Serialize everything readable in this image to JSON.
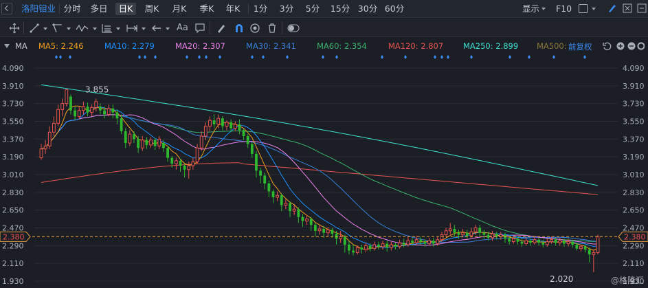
{
  "toolbar": {
    "stock_name": "洛阳钼业",
    "periods": [
      "分时",
      "多日",
      "日K",
      "周K",
      "月K",
      "季K",
      "年K",
      "1分",
      "3分",
      "5分",
      "15分",
      "30分",
      "60分"
    ],
    "active_period": "日K",
    "display_label": "显示",
    "f10_label": "F10"
  },
  "drawing_tools": {
    "icons": [
      "crosshair-icon",
      "line-tool-icon",
      "channel-tool-icon",
      "wave-tool-icon",
      "fib-tool-icon",
      "range-tool-icon",
      "arrow-tool-icon",
      "text-tool-icon",
      "comment-tool-icon",
      "pen-icon",
      "magnet-icon",
      "eye-icon",
      "trash-icon",
      "toggle-icon"
    ],
    "text_tool_label": "Aa"
  },
  "indicator": {
    "name": "MA",
    "adjust_label": "前复权",
    "mas": [
      {
        "label": "MA5: 2.246",
        "color": "#f0a020"
      },
      {
        "label": "MA10: 2.279",
        "color": "#1e90ff"
      },
      {
        "label": "MA20: 2.307",
        "color": "#ee82ee"
      },
      {
        "label": "MA30: 2.341",
        "color": "#3a7fd8"
      },
      {
        "label": "MA60: 2.354",
        "color": "#3cb371"
      },
      {
        "label": "MA120: 2.807",
        "color": "#e8544f"
      },
      {
        "label": "MA250: 2.899",
        "color": "#40e0d0"
      },
      {
        "label": "MA500:",
        "color": "#8a7a3a"
      }
    ]
  },
  "watermark": "@格隆汇",
  "chart_data": {
    "type": "candlestick",
    "y_ticks": [
      4.09,
      3.91,
      3.73,
      3.55,
      3.37,
      3.19,
      3.01,
      2.83,
      2.65,
      2.47,
      2.29,
      2.11,
      1.93
    ],
    "ylim": [
      1.91,
      4.12
    ],
    "current_price": "2.380",
    "annotations": [
      {
        "label": "3.855",
        "value": 3.855
      },
      {
        "label": "2.020",
        "value": 2.02
      }
    ],
    "colors": {
      "up": "#e8544f",
      "down": "#2eb82e"
    },
    "candles": [
      [
        3.18,
        3.27,
        3.16,
        3.32
      ],
      [
        3.27,
        3.3,
        3.22,
        3.36
      ],
      [
        3.3,
        3.44,
        3.27,
        3.5
      ],
      [
        3.44,
        3.53,
        3.4,
        3.6
      ],
      [
        3.53,
        3.67,
        3.5,
        3.72
      ],
      [
        3.67,
        3.73,
        3.6,
        3.78
      ],
      [
        3.73,
        3.87,
        3.7,
        3.86
      ],
      [
        3.8,
        3.66,
        3.62,
        3.82
      ],
      [
        3.66,
        3.6,
        3.56,
        3.7
      ],
      [
        3.6,
        3.66,
        3.57,
        3.7
      ],
      [
        3.66,
        3.7,
        3.62,
        3.75
      ],
      [
        3.7,
        3.64,
        3.6,
        3.74
      ],
      [
        3.64,
        3.69,
        3.6,
        3.72
      ],
      [
        3.69,
        3.75,
        3.65,
        3.78
      ],
      [
        3.7,
        3.66,
        3.62,
        3.73
      ],
      [
        3.66,
        3.62,
        3.58,
        3.7
      ],
      [
        3.62,
        3.68,
        3.6,
        3.72
      ],
      [
        3.68,
        3.64,
        3.58,
        3.72
      ],
      [
        3.64,
        3.58,
        3.52,
        3.67
      ],
      [
        3.58,
        3.45,
        3.42,
        3.62
      ],
      [
        3.45,
        3.33,
        3.28,
        3.48
      ],
      [
        3.33,
        3.42,
        3.3,
        3.46
      ],
      [
        3.42,
        3.37,
        3.33,
        3.45
      ],
      [
        3.37,
        3.28,
        3.23,
        3.4
      ],
      [
        3.28,
        3.36,
        3.25,
        3.4
      ],
      [
        3.36,
        3.31,
        3.27,
        3.39
      ],
      [
        3.31,
        3.36,
        3.28,
        3.39
      ],
      [
        3.36,
        3.3,
        3.26,
        3.38
      ],
      [
        3.3,
        3.37,
        3.27,
        3.4
      ],
      [
        3.33,
        3.28,
        3.24,
        3.36
      ],
      [
        3.28,
        3.18,
        3.14,
        3.3
      ],
      [
        3.18,
        3.12,
        3.08,
        3.2
      ],
      [
        3.12,
        3.15,
        3.06,
        3.18
      ],
      [
        3.15,
        3.1,
        3.04,
        3.17
      ],
      [
        3.1,
        3.06,
        2.98,
        3.12
      ],
      [
        3.06,
        3.1,
        2.97,
        3.14
      ],
      [
        3.1,
        3.14,
        3.06,
        3.18
      ],
      [
        3.14,
        3.28,
        3.12,
        3.32
      ],
      [
        3.28,
        3.4,
        3.25,
        3.45
      ],
      [
        3.4,
        3.5,
        3.36,
        3.54
      ],
      [
        3.5,
        3.56,
        3.45,
        3.6
      ],
      [
        3.56,
        3.52,
        3.48,
        3.62
      ],
      [
        3.52,
        3.58,
        3.48,
        3.62
      ],
      [
        3.58,
        3.5,
        3.46,
        3.6
      ],
      [
        3.5,
        3.54,
        3.46,
        3.56
      ],
      [
        3.54,
        3.48,
        3.44,
        3.57
      ],
      [
        3.48,
        3.52,
        3.45,
        3.55
      ],
      [
        3.52,
        3.46,
        3.42,
        3.57
      ],
      [
        3.46,
        3.4,
        3.36,
        3.48
      ],
      [
        3.4,
        3.32,
        3.28,
        3.42
      ],
      [
        3.32,
        3.22,
        3.18,
        3.34
      ],
      [
        3.22,
        3.05,
        2.98,
        3.25
      ],
      [
        3.05,
        3.0,
        2.92,
        3.08
      ],
      [
        3.0,
        2.92,
        2.86,
        3.03
      ],
      [
        2.92,
        2.84,
        2.78,
        2.95
      ],
      [
        2.84,
        2.78,
        2.72,
        2.86
      ],
      [
        2.78,
        2.8,
        2.74,
        2.84
      ],
      [
        2.8,
        2.7,
        2.64,
        2.82
      ],
      [
        2.7,
        2.72,
        2.66,
        2.76
      ],
      [
        2.72,
        2.64,
        2.58,
        2.74
      ],
      [
        2.64,
        2.66,
        2.6,
        2.7
      ],
      [
        2.66,
        2.58,
        2.52,
        2.68
      ],
      [
        2.58,
        2.54,
        2.48,
        2.61
      ],
      [
        2.54,
        2.56,
        2.5,
        2.6
      ],
      [
        2.56,
        2.5,
        2.44,
        2.58
      ],
      [
        2.5,
        2.44,
        2.38,
        2.52
      ],
      [
        2.44,
        2.46,
        2.4,
        2.5
      ],
      [
        2.46,
        2.42,
        2.37,
        2.49
      ],
      [
        2.42,
        2.45,
        2.38,
        2.48
      ],
      [
        2.45,
        2.41,
        2.37,
        2.47
      ],
      [
        2.41,
        2.36,
        2.3,
        2.44
      ],
      [
        2.36,
        2.38,
        2.32,
        2.44
      ],
      [
        2.38,
        2.3,
        2.22,
        2.4
      ],
      [
        2.3,
        2.24,
        2.2,
        2.34
      ],
      [
        2.24,
        2.22,
        2.19,
        2.3
      ],
      [
        2.22,
        2.27,
        2.2,
        2.29
      ],
      [
        2.27,
        2.25,
        2.21,
        2.3
      ],
      [
        2.25,
        2.29,
        2.22,
        2.32
      ],
      [
        2.29,
        2.26,
        2.23,
        2.31
      ],
      [
        2.26,
        2.3,
        2.24,
        2.33
      ],
      [
        2.3,
        2.28,
        2.25,
        2.33
      ],
      [
        2.28,
        2.31,
        2.25,
        2.34
      ],
      [
        2.31,
        2.27,
        2.23,
        2.34
      ],
      [
        2.27,
        2.3,
        2.24,
        2.33
      ],
      [
        2.3,
        2.28,
        2.25,
        2.32
      ],
      [
        2.28,
        2.32,
        2.26,
        2.35
      ],
      [
        2.32,
        2.3,
        2.27,
        2.36
      ],
      [
        2.3,
        2.34,
        2.28,
        2.38
      ],
      [
        2.34,
        2.32,
        2.29,
        2.37
      ],
      [
        2.32,
        2.35,
        2.3,
        2.39
      ],
      [
        2.35,
        2.33,
        2.3,
        2.38
      ],
      [
        2.33,
        2.31,
        2.28,
        2.36
      ],
      [
        2.31,
        2.34,
        2.29,
        2.37
      ],
      [
        2.34,
        2.31,
        2.28,
        2.37
      ],
      [
        2.31,
        2.35,
        2.29,
        2.38
      ],
      [
        2.35,
        2.4,
        2.33,
        2.43
      ],
      [
        2.4,
        2.44,
        2.38,
        2.47
      ],
      [
        2.44,
        2.46,
        2.4,
        2.52
      ],
      [
        2.46,
        2.42,
        2.38,
        2.5
      ],
      [
        2.42,
        2.4,
        2.36,
        2.45
      ],
      [
        2.4,
        2.42,
        2.37,
        2.46
      ],
      [
        2.42,
        2.39,
        2.36,
        2.45
      ],
      [
        2.39,
        2.43,
        2.37,
        2.47
      ],
      [
        2.43,
        2.47,
        2.4,
        2.5
      ],
      [
        2.47,
        2.42,
        2.38,
        2.5
      ],
      [
        2.42,
        2.4,
        2.36,
        2.45
      ],
      [
        2.4,
        2.37,
        2.34,
        2.43
      ],
      [
        2.37,
        2.41,
        2.34,
        2.44
      ],
      [
        2.41,
        2.38,
        2.35,
        2.43
      ],
      [
        2.38,
        2.4,
        2.35,
        2.43
      ],
      [
        2.4,
        2.36,
        2.32,
        2.42
      ],
      [
        2.36,
        2.33,
        2.3,
        2.39
      ],
      [
        2.33,
        2.36,
        2.31,
        2.39
      ],
      [
        2.36,
        2.33,
        2.3,
        2.38
      ],
      [
        2.33,
        2.31,
        2.28,
        2.36
      ],
      [
        2.31,
        2.34,
        2.29,
        2.37
      ],
      [
        2.34,
        2.32,
        2.29,
        2.36
      ],
      [
        2.32,
        2.35,
        2.3,
        2.38
      ],
      [
        2.35,
        2.32,
        2.29,
        2.37
      ],
      [
        2.32,
        2.3,
        2.27,
        2.35
      ],
      [
        2.3,
        2.33,
        2.28,
        2.36
      ],
      [
        2.33,
        2.35,
        2.31,
        2.38
      ],
      [
        2.35,
        2.32,
        2.29,
        2.37
      ],
      [
        2.32,
        2.34,
        2.29,
        2.37
      ],
      [
        2.34,
        2.31,
        2.28,
        2.36
      ],
      [
        2.31,
        2.33,
        2.28,
        2.36
      ],
      [
        2.33,
        2.3,
        2.27,
        2.35
      ],
      [
        2.3,
        2.26,
        2.24,
        2.32
      ],
      [
        2.26,
        2.28,
        2.23,
        2.3
      ],
      [
        2.28,
        2.25,
        2.22,
        2.3
      ],
      [
        2.25,
        2.2,
        2.12,
        2.27
      ],
      [
        2.2,
        2.22,
        2.02,
        2.25
      ],
      [
        2.22,
        2.38,
        2.2,
        2.4
      ]
    ]
  }
}
